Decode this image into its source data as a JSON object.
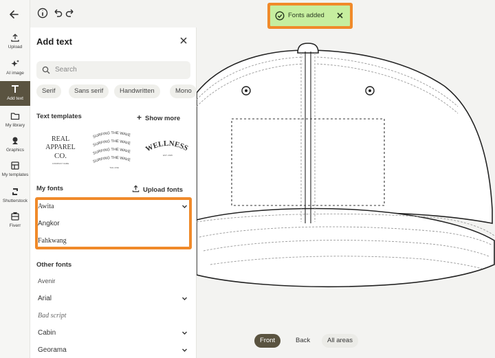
{
  "rail": {
    "items": [
      {
        "label": "Upload",
        "icon": "upload-icon"
      },
      {
        "label": "AI image",
        "icon": "sparkle-icon"
      },
      {
        "label": "Add text",
        "icon": "text-icon",
        "active": true
      },
      {
        "label": "My library",
        "icon": "folder-icon"
      },
      {
        "label": "Graphics",
        "icon": "graphics-icon"
      },
      {
        "label": "My templates",
        "icon": "templates-icon"
      },
      {
        "label": "Shutterstock",
        "icon": "shutterstock-icon"
      },
      {
        "label": "Fiverr",
        "icon": "fiverr-icon"
      }
    ]
  },
  "panel": {
    "title": "Add text",
    "search_placeholder": "Search",
    "chips": [
      "Serif",
      "Sans serif",
      "Handwritten",
      "Mono"
    ],
    "templates_label": "Text templates",
    "show_more": "Show more",
    "templates": [
      {
        "line1": "REAL",
        "line2": "APPAREL",
        "line3": "CO.",
        "line4": "COMPANY NAME"
      },
      {
        "text": "SURFING THE WAVE",
        "line_small": "TAG LINE"
      },
      {
        "text": "WELLNESS",
        "line_small": "EST. 2025"
      }
    ],
    "my_fonts_label": "My fonts",
    "upload_fonts": "Upload fonts",
    "my_fonts": [
      "Awita",
      "Angkor",
      "Fahkwang"
    ],
    "other_fonts_label": "Other fonts",
    "other_fonts": [
      "Avenir",
      "Arial",
      "Bad script",
      "Cabin",
      "Georama"
    ]
  },
  "toast": {
    "text": "Fonts added"
  },
  "views": {
    "front": "Front",
    "back": "Back",
    "all": "All areas"
  },
  "colors": {
    "accent": "#5a5340",
    "highlight": "#f08a2a",
    "toast_bg": "#c6ee9f"
  }
}
